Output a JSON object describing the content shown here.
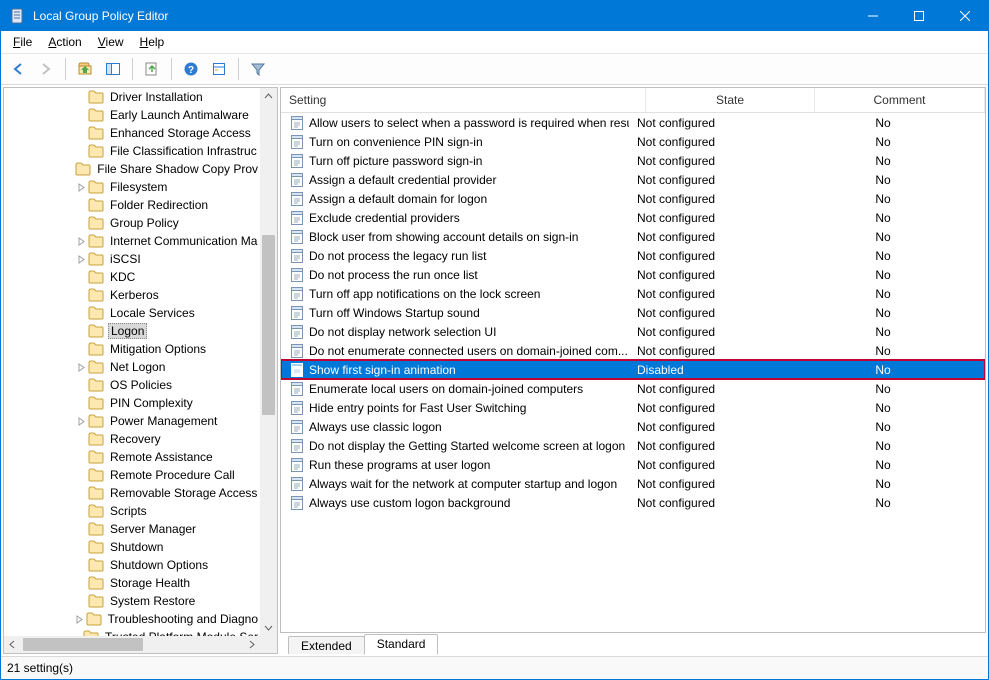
{
  "window": {
    "title": "Local Group Policy Editor"
  },
  "menu": {
    "file": "File",
    "action": "Action",
    "view": "View",
    "help": "Help"
  },
  "tree": {
    "items": [
      {
        "label": "Driver Installation"
      },
      {
        "label": "Early Launch Antimalware"
      },
      {
        "label": "Enhanced Storage Access"
      },
      {
        "label": "File Classification Infrastruc"
      },
      {
        "label": "File Share Shadow Copy Prov"
      },
      {
        "label": "Filesystem",
        "expandable": true
      },
      {
        "label": "Folder Redirection"
      },
      {
        "label": "Group Policy"
      },
      {
        "label": "Internet Communication Ma",
        "expandable": true
      },
      {
        "label": "iSCSI",
        "expandable": true
      },
      {
        "label": "KDC"
      },
      {
        "label": "Kerberos"
      },
      {
        "label": "Locale Services"
      },
      {
        "label": "Logon",
        "selected": true
      },
      {
        "label": "Mitigation Options"
      },
      {
        "label": "Net Logon",
        "expandable": true
      },
      {
        "label": "OS Policies"
      },
      {
        "label": "PIN Complexity"
      },
      {
        "label": "Power Management",
        "expandable": true
      },
      {
        "label": "Recovery"
      },
      {
        "label": "Remote Assistance"
      },
      {
        "label": "Remote Procedure Call"
      },
      {
        "label": "Removable Storage Access"
      },
      {
        "label": "Scripts"
      },
      {
        "label": "Server Manager"
      },
      {
        "label": "Shutdown"
      },
      {
        "label": "Shutdown Options"
      },
      {
        "label": "Storage Health"
      },
      {
        "label": "System Restore"
      },
      {
        "label": "Troubleshooting and Diagno",
        "expandable": true
      },
      {
        "label": "Trusted Platform Module Ser"
      }
    ]
  },
  "list": {
    "columns": {
      "setting": "Setting",
      "state": "State",
      "comment": "Comment"
    },
    "rows": [
      {
        "setting": "Allow users to select when a password is required when resu...",
        "state": "Not configured",
        "comment": "No"
      },
      {
        "setting": "Turn on convenience PIN sign-in",
        "state": "Not configured",
        "comment": "No"
      },
      {
        "setting": "Turn off picture password sign-in",
        "state": "Not configured",
        "comment": "No"
      },
      {
        "setting": "Assign a default credential provider",
        "state": "Not configured",
        "comment": "No"
      },
      {
        "setting": "Assign a default domain for logon",
        "state": "Not configured",
        "comment": "No"
      },
      {
        "setting": "Exclude credential providers",
        "state": "Not configured",
        "comment": "No"
      },
      {
        "setting": "Block user from showing account details on sign-in",
        "state": "Not configured",
        "comment": "No"
      },
      {
        "setting": "Do not process the legacy run list",
        "state": "Not configured",
        "comment": "No"
      },
      {
        "setting": "Do not process the run once list",
        "state": "Not configured",
        "comment": "No"
      },
      {
        "setting": "Turn off app notifications on the lock screen",
        "state": "Not configured",
        "comment": "No"
      },
      {
        "setting": "Turn off Windows Startup sound",
        "state": "Not configured",
        "comment": "No"
      },
      {
        "setting": "Do not display network selection UI",
        "state": "Not configured",
        "comment": "No"
      },
      {
        "setting": "Do not enumerate connected users on domain-joined com...",
        "state": "Not configured",
        "comment": "No"
      },
      {
        "setting": "Show first sign-in animation",
        "state": "Disabled",
        "comment": "No",
        "selected": true
      },
      {
        "setting": "Enumerate local users on domain-joined computers",
        "state": "Not configured",
        "comment": "No"
      },
      {
        "setting": "Hide entry points for Fast User Switching",
        "state": "Not configured",
        "comment": "No"
      },
      {
        "setting": "Always use classic logon",
        "state": "Not configured",
        "comment": "No"
      },
      {
        "setting": "Do not display the Getting Started welcome screen at logon",
        "state": "Not configured",
        "comment": "No"
      },
      {
        "setting": "Run these programs at user logon",
        "state": "Not configured",
        "comment": "No"
      },
      {
        "setting": "Always wait for the network at computer startup and logon",
        "state": "Not configured",
        "comment": "No"
      },
      {
        "setting": "Always use custom logon background",
        "state": "Not configured",
        "comment": "No"
      }
    ]
  },
  "tabs": {
    "extended": "Extended",
    "standard": "Standard"
  },
  "status": {
    "text": "21 setting(s)"
  }
}
